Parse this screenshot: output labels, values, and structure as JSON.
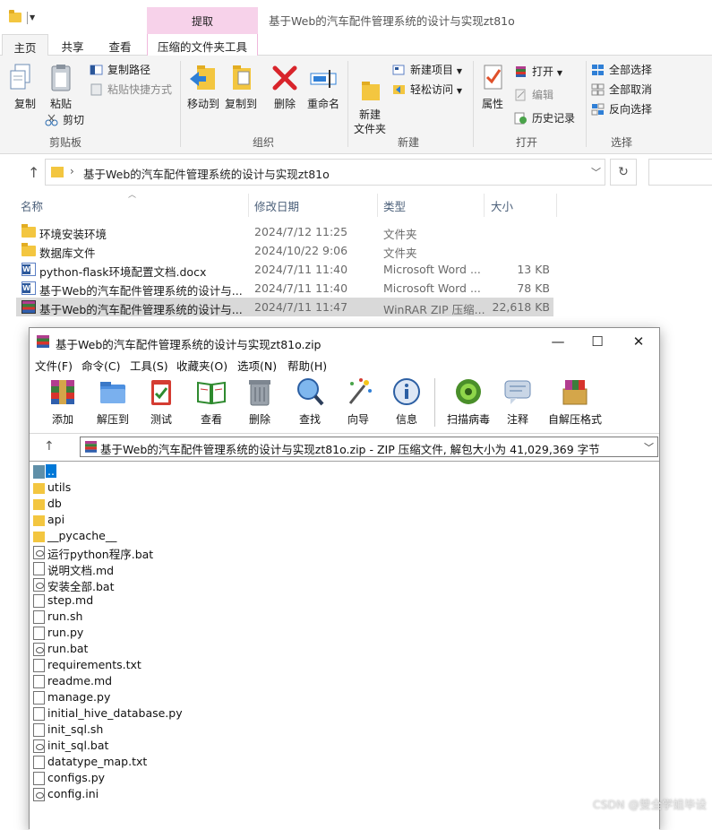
{
  "explorer": {
    "window_title": "基于Web的汽车配件管理系统的设计与实现zt81o",
    "context_tab_header": "提取",
    "tabs": [
      "主页",
      "共享",
      "查看",
      "压缩的文件夹工具"
    ],
    "ribbon": {
      "clipboard": {
        "copy": "复制",
        "paste": "粘贴",
        "copy_path": "复制路径",
        "paste_shortcut": "粘贴快捷方式",
        "cut": "剪切",
        "group": "剪贴板"
      },
      "organize": {
        "move_to": "移动到",
        "copy_to": "复制到",
        "delete": "删除",
        "rename": "重命名",
        "group": "组织"
      },
      "new": {
        "new_folder": "新建\n文件夹",
        "new_item": "新建项目",
        "easy_access": "轻松访问",
        "group": "新建"
      },
      "open": {
        "properties": "属性",
        "open": "打开",
        "edit": "编辑",
        "history": "历史记录",
        "group": "打开"
      },
      "select": {
        "select_all": "全部选择",
        "select_none": "全部取消",
        "invert": "反向选择",
        "group": "选择"
      }
    },
    "address": "基于Web的汽车配件管理系统的设计与实现zt81o",
    "columns": {
      "name": "名称",
      "date": "修改日期",
      "type": "类型",
      "size": "大小"
    },
    "files": [
      {
        "name": "环境安装环境",
        "date": "2024/7/12 11:25",
        "type": "文件夹",
        "size": "",
        "icon": "folder-icon"
      },
      {
        "name": "数据库文件",
        "date": "2024/10/22 9:06",
        "type": "文件夹",
        "size": "",
        "icon": "folder-icon"
      },
      {
        "name": "python-flask环境配置文档.docx",
        "date": "2024/7/11 11:40",
        "type": "Microsoft Word ...",
        "size": "13 KB",
        "icon": "word-icon"
      },
      {
        "name": "基于Web的汽车配件管理系统的设计与...",
        "date": "2024/7/11 11:40",
        "type": "Microsoft Word ...",
        "size": "78 KB",
        "icon": "word-icon"
      },
      {
        "name": "基于Web的汽车配件管理系统的设计与...",
        "date": "2024/7/11 11:47",
        "type": "WinRAR ZIP 压缩...",
        "size": "22,618 KB",
        "icon": "winrar-icon"
      }
    ]
  },
  "winrar": {
    "title": "基于Web的汽车配件管理系统的设计与实现zt81o.zip",
    "menu": [
      "文件(F)",
      "命令(C)",
      "工具(S)",
      "收藏夹(O)",
      "选项(N)",
      "帮助(H)"
    ],
    "toolbar": [
      "添加",
      "解压到",
      "测试",
      "查看",
      "删除",
      "查找",
      "向导",
      "信息",
      "扫描病毒",
      "注释",
      "自解压格式"
    ],
    "path": "基于Web的汽车配件管理系统的设计与实现zt81o.zip - ZIP 压缩文件, 解包大小为 41,029,369 字节",
    "items": [
      {
        "name": "..",
        "kind": "up"
      },
      {
        "name": "utils",
        "kind": "folder"
      },
      {
        "name": "db",
        "kind": "folder"
      },
      {
        "name": "api",
        "kind": "folder"
      },
      {
        "name": "__pycache__",
        "kind": "folder"
      },
      {
        "name": "运行python程序.bat",
        "kind": "bat"
      },
      {
        "name": "说明文档.md",
        "kind": "file"
      },
      {
        "name": "安装全部.bat",
        "kind": "bat"
      },
      {
        "name": "step.md",
        "kind": "file"
      },
      {
        "name": "run.sh",
        "kind": "file"
      },
      {
        "name": "run.py",
        "kind": "file"
      },
      {
        "name": "run.bat",
        "kind": "bat"
      },
      {
        "name": "requirements.txt",
        "kind": "file"
      },
      {
        "name": "readme.md",
        "kind": "file"
      },
      {
        "name": "manage.py",
        "kind": "file"
      },
      {
        "name": "initial_hive_database.py",
        "kind": "file"
      },
      {
        "name": "init_sql.sh",
        "kind": "file"
      },
      {
        "name": "init_sql.bat",
        "kind": "bat"
      },
      {
        "name": "datatype_map.txt",
        "kind": "file"
      },
      {
        "name": "configs.py",
        "kind": "file"
      },
      {
        "name": "config.ini",
        "kind": "bat"
      }
    ]
  },
  "watermark": "CSDN @雙全学姐毕设"
}
